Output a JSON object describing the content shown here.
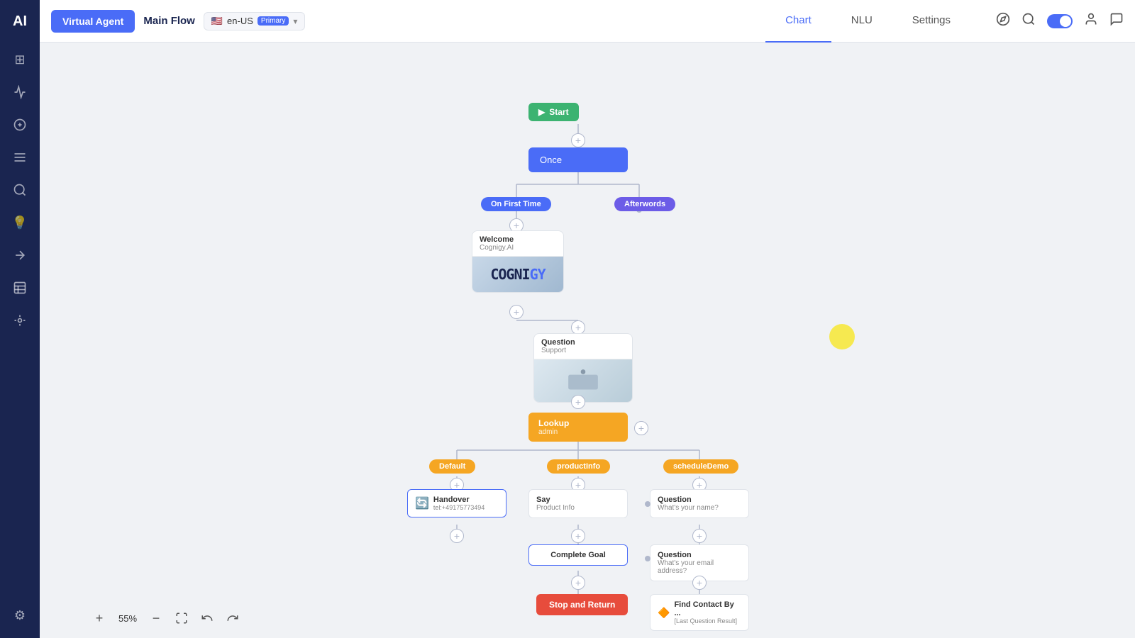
{
  "sidebar": {
    "logo": "AI",
    "items": [
      {
        "name": "grid-icon",
        "icon": "⊞",
        "active": false
      },
      {
        "name": "flows-icon",
        "icon": "◇",
        "active": false
      },
      {
        "name": "nlu-icon",
        "icon": "☁",
        "active": false
      },
      {
        "name": "list-icon",
        "icon": "☰",
        "active": false
      },
      {
        "name": "analytics-icon",
        "icon": "⚡",
        "active": false
      },
      {
        "name": "knowledge-icon",
        "icon": "💡",
        "active": false
      },
      {
        "name": "handover-icon",
        "icon": "→",
        "active": false
      },
      {
        "name": "logs-icon",
        "icon": "≡",
        "active": false
      },
      {
        "name": "connections-icon",
        "icon": "⊕",
        "active": false
      }
    ],
    "bottom_items": [
      {
        "name": "settings-icon",
        "icon": "⚙",
        "active": false
      }
    ]
  },
  "header": {
    "virtual_agent_label": "Virtual Agent",
    "flow_name": "Main Flow",
    "flag": "🇺🇸",
    "language_code": "en-US",
    "language_badge": "Primary",
    "tabs": [
      {
        "label": "Chart",
        "active": true
      },
      {
        "label": "NLU",
        "active": false
      },
      {
        "label": "Settings",
        "active": false
      }
    ],
    "icons": {
      "compass": "🧭",
      "search": "🔍",
      "user": "👤",
      "chat": "💬"
    }
  },
  "chart": {
    "nodes": {
      "start": {
        "label": "Start"
      },
      "once": {
        "label": "Once"
      },
      "on_first_time": {
        "label": "On First Time"
      },
      "afterwords": {
        "label": "Afterwords"
      },
      "welcome": {
        "title": "Welcome",
        "subtitle": "Cognigy.AI"
      },
      "question_support": {
        "title": "Question",
        "subtitle": "Support"
      },
      "lookup": {
        "title": "Lookup",
        "subtitle": "admin"
      },
      "default_pill": {
        "label": "Default"
      },
      "product_info_pill": {
        "label": "productInfo"
      },
      "schedule_demo_pill": {
        "label": "scheduleDemo"
      },
      "handover": {
        "title": "Handover",
        "subtitle": "tel:+49175773494"
      },
      "say": {
        "title": "Say",
        "subtitle": "Product Info"
      },
      "question_name": {
        "title": "Question",
        "subtitle": "What's your name?"
      },
      "complete_goal": {
        "title": "Complete Goal"
      },
      "question_email": {
        "title": "Question",
        "subtitle": "What's your email address?"
      },
      "stop_return": {
        "label": "Stop and Return"
      },
      "find_contact": {
        "title": "Find Contact By ...",
        "subtitle": "[Last Question Result]"
      }
    }
  },
  "toolbar": {
    "zoom_level": "55%",
    "plus_label": "+",
    "minus_label": "−"
  }
}
